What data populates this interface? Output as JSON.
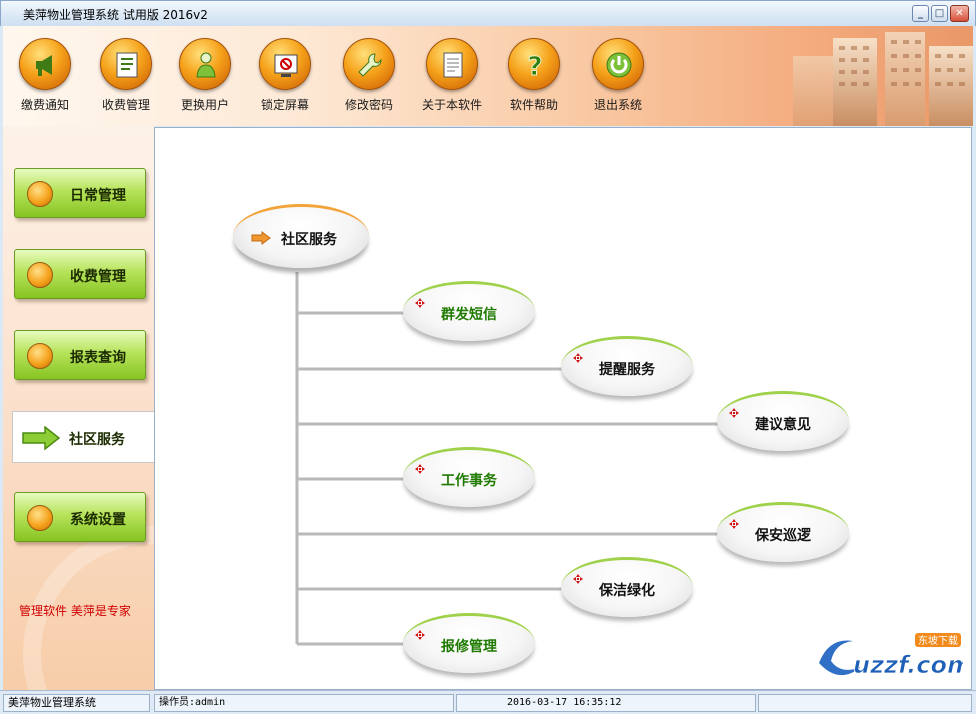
{
  "window": {
    "title": "美萍物业管理系统 试用版 2016v2"
  },
  "toolbar": {
    "items": [
      {
        "label": "缴费通知",
        "icon": "megaphone-icon"
      },
      {
        "label": "收费管理",
        "icon": "document-icon"
      },
      {
        "label": "更换用户",
        "icon": "user-icon"
      },
      {
        "label": "锁定屏幕",
        "icon": "lock-screen-icon"
      },
      {
        "label": "修改密码",
        "icon": "wrench-icon"
      },
      {
        "label": "关于本软件",
        "icon": "notepad-icon"
      },
      {
        "label": "软件帮助",
        "icon": "help-icon"
      },
      {
        "label": "退出系统",
        "icon": "power-icon"
      }
    ]
  },
  "sidebar": {
    "items": [
      {
        "label": "日常管理"
      },
      {
        "label": "收费管理"
      },
      {
        "label": "报表查询"
      },
      {
        "label": "社区服务",
        "active": true
      },
      {
        "label": "系统设置"
      }
    ],
    "slogan": "管理软件  美萍是专家"
  },
  "tree": {
    "root": "社区服务",
    "children": [
      {
        "label": "群发短信",
        "color": "#1f7a00"
      },
      {
        "label": "提醒服务",
        "color": "#111111"
      },
      {
        "label": "建议意见",
        "color": "#111111"
      },
      {
        "label": "工作事务",
        "color": "#1f7a00"
      },
      {
        "label": "保安巡逻",
        "color": "#111111"
      },
      {
        "label": "保洁绿化",
        "color": "#111111"
      },
      {
        "label": "报修管理",
        "color": "#1f7a00"
      }
    ]
  },
  "watermark": {
    "text": "uzzf.com",
    "tag": "东坡下载"
  },
  "statusbar": {
    "app": "美萍物业管理系统",
    "operator": "操作员:admin",
    "datetime": "2016-03-17  16:35:12"
  }
}
